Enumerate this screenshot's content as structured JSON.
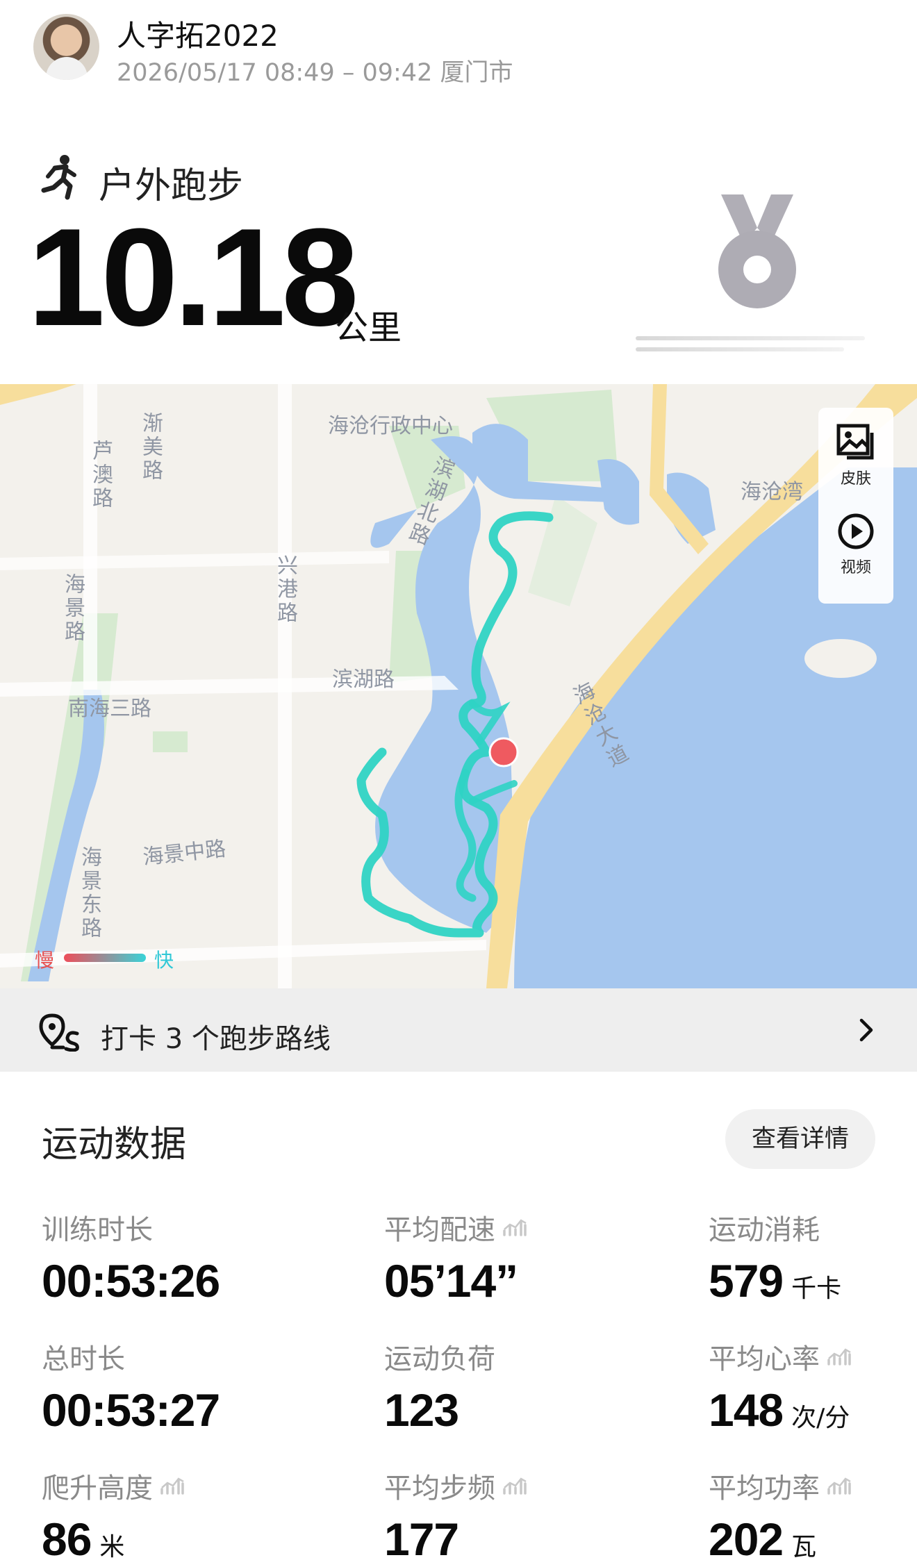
{
  "header": {
    "username": "人字拓2022",
    "subline": "2026/05/17 08:49 – 09:42 厦门市"
  },
  "activity": {
    "type": "户外跑步",
    "distance": "10.18",
    "unit": "公里"
  },
  "map": {
    "labels": {
      "haicang_admin": "海沧行政中心",
      "binhu_north": "滨湖北路",
      "lu_ao_road": "芦澳路",
      "jianmei_road": "渐美路",
      "haijing_road": "海景路",
      "xinggang_road": "兴港路",
      "binhu_road": "滨湖路",
      "nanhai_3": "南海三路",
      "haijing_middle": "海景中路",
      "haijing_east": "海景东路",
      "haicang_bay": "海沧湾",
      "haicang_avenue": "海沧大道"
    },
    "side_buttons": {
      "skin": "皮肤",
      "video": "视频"
    },
    "legend": {
      "slow": "慢",
      "fast": "快"
    },
    "colors": {
      "water": "#a5c6ee",
      "route": "#2fd3c4",
      "marker": "#ef5a60",
      "road": "#f7de9c"
    }
  },
  "route_bar": {
    "text": "打卡 3 个跑步路线"
  },
  "stats": {
    "title": "运动数据",
    "detail_button": "查看详情",
    "items": [
      {
        "label": "训练时长",
        "value": "00:53:26",
        "unit": "",
        "trend": false
      },
      {
        "label": "平均配速",
        "value": "05’14”",
        "unit": "",
        "trend": true
      },
      {
        "label": "运动消耗",
        "value": "579",
        "unit": "千卡",
        "trend": false
      },
      {
        "label": "总时长",
        "value": "00:53:27",
        "unit": "",
        "trend": false
      },
      {
        "label": "运动负荷",
        "value": "123",
        "unit": "",
        "trend": false
      },
      {
        "label": "平均心率",
        "value": "148",
        "unit": "次/分",
        "trend": true
      },
      {
        "label": "爬升高度",
        "value": "86",
        "unit": "米",
        "trend": true
      },
      {
        "label": "平均步频",
        "value": "177",
        "unit": "",
        "trend": true
      },
      {
        "label": "平均功率",
        "value": "202",
        "unit": "瓦",
        "trend": true
      }
    ]
  }
}
